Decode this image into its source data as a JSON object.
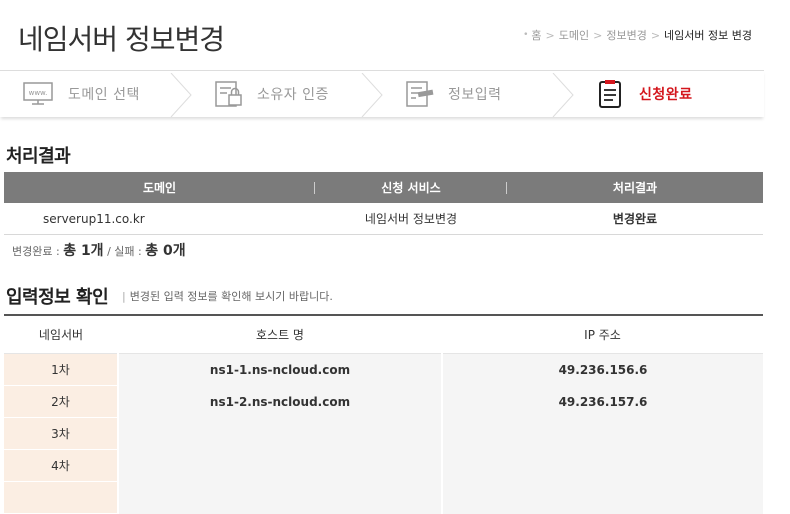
{
  "page": {
    "title": "네임서버 정보변경",
    "breadcrumb": [
      "홈",
      "도메인",
      "정보변경",
      "네임서버 정보 변경"
    ]
  },
  "steps": [
    {
      "label": "도메인 선택",
      "icon": "www-monitor-icon",
      "active": false
    },
    {
      "label": "소유자 인증",
      "icon": "document-lock-icon",
      "active": false
    },
    {
      "label": "정보입력",
      "icon": "document-edit-icon",
      "active": false
    },
    {
      "label": "신청완료",
      "icon": "document-list-icon",
      "active": true
    }
  ],
  "result": {
    "title": "처리결과",
    "headers": [
      "도메인",
      "신청 서비스",
      "처리결과"
    ],
    "rows": [
      {
        "domain": "serverup11.co.kr",
        "service": "네임서버 정보변경",
        "status": "변경완료"
      }
    ],
    "summary": {
      "done_label": "변경완료 : ",
      "done_value": "총 1개",
      "slash": " / ",
      "fail_label": "실패 : ",
      "fail_value": "총 0개"
    }
  },
  "input_info": {
    "title": "입력정보 확인",
    "subtitle": "변경된 입력 정보를 확인해 보시기 바랍니다.",
    "headers": [
      "네임서버",
      "호스트 명",
      "IP 주소"
    ],
    "rows": [
      {
        "order": "1차",
        "host": "ns1-1.ns-ncloud.com",
        "ip": "49.236.156.6"
      },
      {
        "order": "2차",
        "host": "ns1-2.ns-ncloud.com",
        "ip": "49.236.157.6"
      },
      {
        "order": "3차",
        "host": "",
        "ip": ""
      },
      {
        "order": "4차",
        "host": "",
        "ip": ""
      },
      {
        "order": "",
        "host": "",
        "ip": ""
      }
    ]
  },
  "colors": {
    "accent": "#d4161d",
    "header_bg": "#7b7b7b",
    "order_bg": "#fbeee3"
  }
}
